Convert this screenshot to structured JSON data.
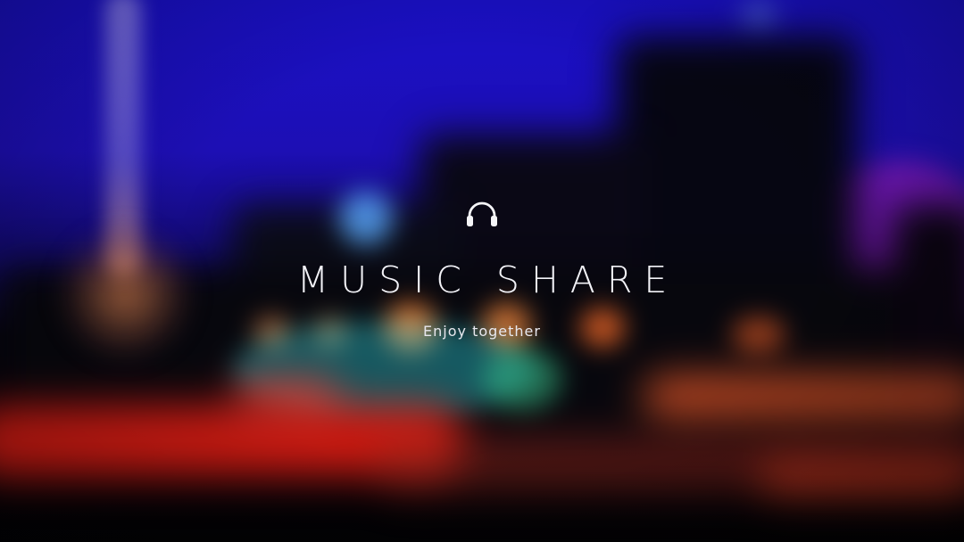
{
  "app": {
    "title": "MUSIC SHARE",
    "tagline": "Enjoy together",
    "logo_icon": "headphones-icon"
  },
  "theme": {
    "text_color": "#f2f2f7",
    "sky_color": "#1a10c8"
  }
}
